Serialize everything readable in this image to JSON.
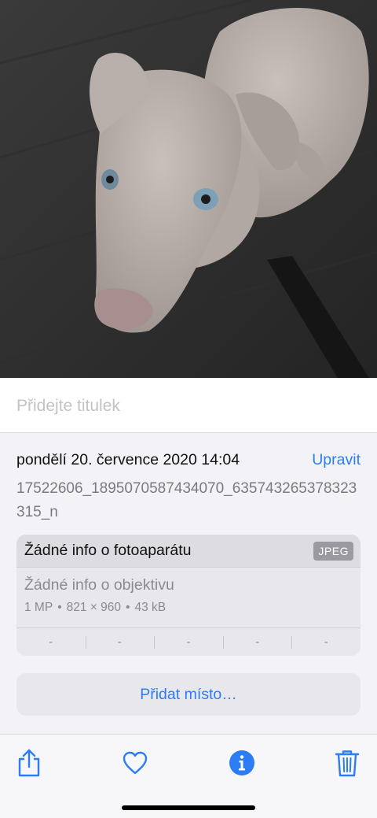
{
  "caption": {
    "placeholder": "Přidejte titulek"
  },
  "info": {
    "date": "pondělí 20. července 2020 14:04",
    "edit_label": "Upravit",
    "filename": "17522606_1895070587434070_635743265378323315_n"
  },
  "metadata": {
    "camera": "Žádné info o fotoaparátu",
    "format": "JPEG",
    "lens": "Žádné info o objektivu",
    "megapixels": "1 MP",
    "dimensions": "821 × 960",
    "file_size": "43 kB",
    "separator": "•",
    "exif": [
      "-",
      "-",
      "-",
      "-",
      "-"
    ]
  },
  "add_place_label": "Přidat místo…",
  "toolbar": {
    "icons": [
      "share-icon",
      "heart-icon",
      "info-icon",
      "trash-icon"
    ],
    "accent_color": "#2c7cf6"
  }
}
